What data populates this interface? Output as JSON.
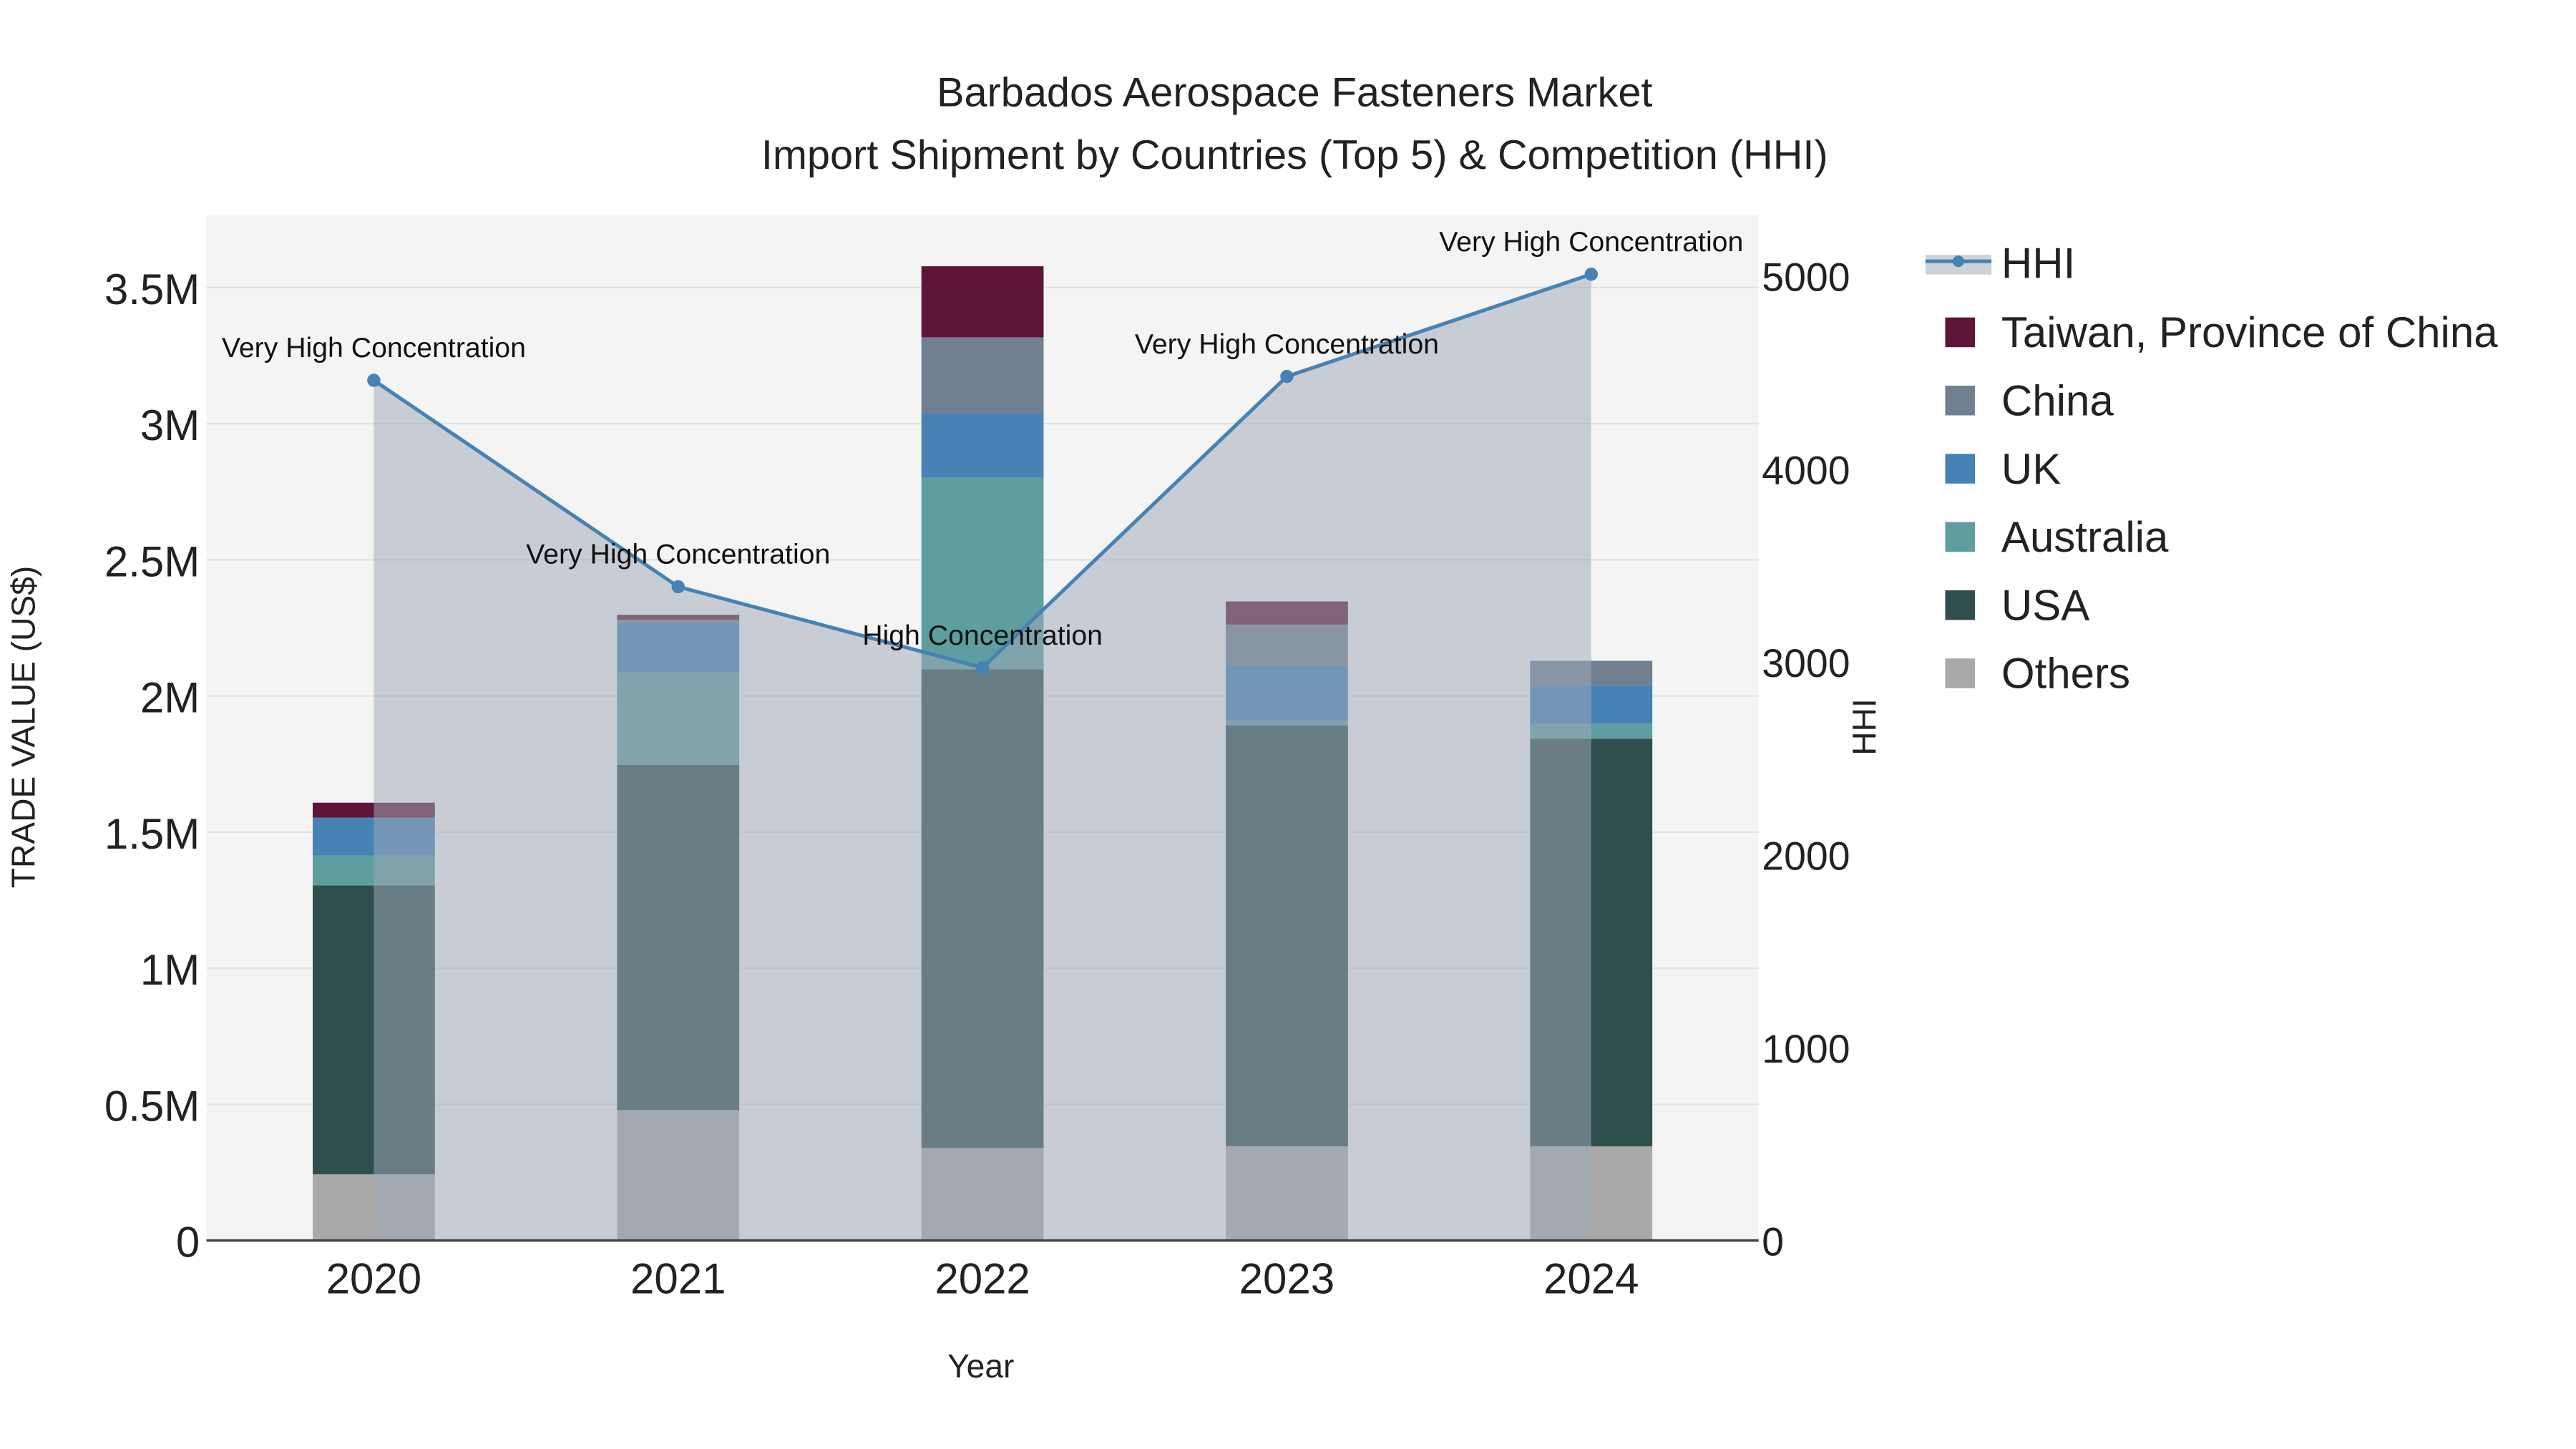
{
  "chart_data": {
    "type": "bar",
    "title_line1": "Barbados Aerospace Fasteners Market",
    "title_line2": "Import Shipment by Countries (Top 5) & Competition (HHI)",
    "xlabel": "Year",
    "ylabel": "TRADE VALUE (US$)",
    "y2label": "HHI",
    "categories": [
      "2020",
      "2021",
      "2022",
      "2023",
      "2024"
    ],
    "ylim": [
      0,
      3750000
    ],
    "y2lim": [
      0,
      5300
    ],
    "yticks": [
      {
        "v": 0,
        "label": "0"
      },
      {
        "v": 500000,
        "label": "0.5M"
      },
      {
        "v": 1000000,
        "label": "1M"
      },
      {
        "v": 1500000,
        "label": "1.5M"
      },
      {
        "v": 2000000,
        "label": "2M"
      },
      {
        "v": 2500000,
        "label": "2.5M"
      },
      {
        "v": 3000000,
        "label": "3M"
      },
      {
        "v": 3500000,
        "label": "3.5M"
      }
    ],
    "y2ticks": [
      {
        "v": 0,
        "label": "0"
      },
      {
        "v": 1000,
        "label": "1000"
      },
      {
        "v": 2000,
        "label": "2000"
      },
      {
        "v": 3000,
        "label": "3000"
      },
      {
        "v": 4000,
        "label": "4000"
      },
      {
        "v": 5000,
        "label": "5000"
      }
    ],
    "series": [
      {
        "name": "Others",
        "color": "#a9a9a9",
        "values": [
          243000,
          479000,
          340000,
          346000,
          346000
        ]
      },
      {
        "name": "USA",
        "color": "#2f4f4f",
        "values": [
          1061000,
          1268000,
          1758000,
          1546000,
          1497000
        ]
      },
      {
        "name": "Australia",
        "color": "#5f9ea0",
        "values": [
          110000,
          339000,
          704000,
          18000,
          55000
        ]
      },
      {
        "name": "UK",
        "color": "#4682b4",
        "values": [
          139000,
          182000,
          236000,
          200000,
          140000
        ]
      },
      {
        "name": "China",
        "color": "#708090",
        "values": [
          0,
          12000,
          279000,
          152000,
          91000
        ]
      },
      {
        "name": "Taiwan, Province of China",
        "color": "#5f1538",
        "values": [
          55000,
          18000,
          261000,
          85000,
          0
        ]
      }
    ],
    "hhi": {
      "name": "HHI",
      "color": "#4682b4",
      "values": [
        4460,
        3390,
        2970,
        4480,
        5010
      ],
      "annotations": [
        "Very High Concentration",
        "Very High Concentration",
        "High Concentration",
        "Very High Concentration",
        "Very High Concentration"
      ]
    },
    "legend": [
      "HHI",
      "Taiwan, Province of China",
      "China",
      "UK",
      "Australia",
      "USA",
      "Others"
    ],
    "legend_placement": "right",
    "grid": true
  }
}
